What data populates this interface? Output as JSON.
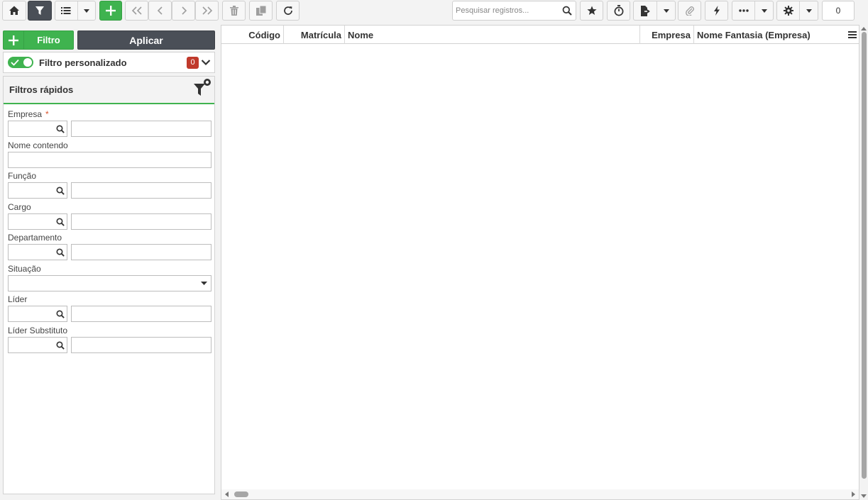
{
  "toolbar": {
    "search_placeholder": "Pesquisar registros...",
    "record_count": "0",
    "accent_color": "#3fb34f",
    "active_color": "#4a4f57"
  },
  "filter_panel": {
    "add_filter_label": "Filtro",
    "apply_label": "Aplicar",
    "custom_filter": {
      "title": "Filtro personalizado",
      "count": "0",
      "enabled": true
    },
    "quick_filters": {
      "title": "Filtros rápidos",
      "fields": {
        "empresa": {
          "label": "Empresa",
          "required_mark": "*"
        },
        "nome": {
          "label": "Nome contendo"
        },
        "funcao": {
          "label": "Função"
        },
        "cargo": {
          "label": "Cargo"
        },
        "departamento": {
          "label": "Departamento"
        },
        "situacao": {
          "label": "Situação"
        },
        "lider": {
          "label": "Líder"
        },
        "lider_substituto": {
          "label": "Líder Substituto"
        }
      }
    }
  },
  "grid": {
    "columns": [
      "Código",
      "Matrícula",
      "Nome",
      "Empresa",
      "Nome Fantasia (Empresa)"
    ],
    "rows": []
  }
}
